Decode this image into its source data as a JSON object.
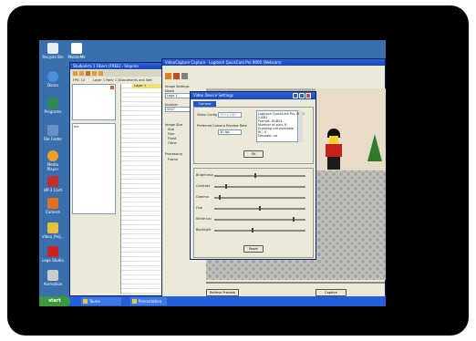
{
  "desktop": {
    "icons": [
      {
        "label": "Recycle Bin",
        "color": "#d9e6f2"
      },
      {
        "label": "Doron",
        "color": "#4a90d9"
      },
      {
        "label": "Programs",
        "color": "#2e8b57"
      },
      {
        "label": "File Folder",
        "color": "#6a8fc4"
      },
      {
        "label": "Media Player",
        "color": "#f0a020"
      },
      {
        "label": "HP-3 Cord",
        "color": "#c03030"
      },
      {
        "label": "Camera",
        "color": "#e07020"
      },
      {
        "label": "Video_Proj...",
        "color": "#e8c040"
      },
      {
        "label": "Lego Studio",
        "color": "#d02020"
      },
      {
        "label": "Animation",
        "color": "#cccccc"
      }
    ],
    "top_icon_label": "MobileMe"
  },
  "taskbar": {
    "start_label": "start",
    "tasks": [
      "Tauna",
      "Presentation"
    ],
    "accent": "#245edb"
  },
  "animator_window": {
    "title": "StudioArts 1 Fibers (FREE) - Stopmo",
    "toolbar_label": "FPS: 10",
    "layer_label": "Layer 1 Path: C:\\Documents and Sett",
    "column_header": "Layer 1",
    "list_label": "Ink"
  },
  "capture_window": {
    "title": "VideoCapture Capture - Logitech QuickCam Pro 9000 (Webcam)",
    "side_labels": {
      "image_settings": "Image Settings",
      "name": "Name",
      "name_value": "Lego 1",
      "number": "Number",
      "number_value": "0007",
      "image size": "Image Size",
      "opt1": "Size",
      "opt2": "Free",
      "opt3": "Fixed",
      "opt4": "Other",
      "processing": "Processing",
      "process_opt": "Frame"
    },
    "bottom_buttons": {
      "refresh": "Refresh Preview",
      "capture": "Capture"
    }
  },
  "video_dialog": {
    "title": "Video Device Settings",
    "tab": "Camera Setting",
    "video_config_label": "Video Config",
    "video_config_value": "320 x 240",
    "preferred_label": "Preferred Camera Preview Rate",
    "preferred_value": "30 fps",
    "info_lines": [
      "Logitech QuickCam Pro 9000",
      "(USB)",
      "Format: RGB24",
      "Number of pins: 6",
      "Enabling not available",
      "RC: 0",
      "Decoder: no"
    ],
    "ok_label": "OK",
    "sliders": [
      {
        "label": "Brightness",
        "value": 0.45
      },
      {
        "label": "Contrast",
        "value": 0.12
      },
      {
        "label": "Gamma",
        "value": 0.05
      },
      {
        "label": "Hue",
        "value": 0.5
      },
      {
        "label": "White bal",
        "value": 0.88
      },
      {
        "label": "Backlight",
        "value": 0.42
      }
    ],
    "reset_label": "Reset"
  },
  "minimize_label": "_",
  "maximize_label": "□",
  "close_label": "x"
}
